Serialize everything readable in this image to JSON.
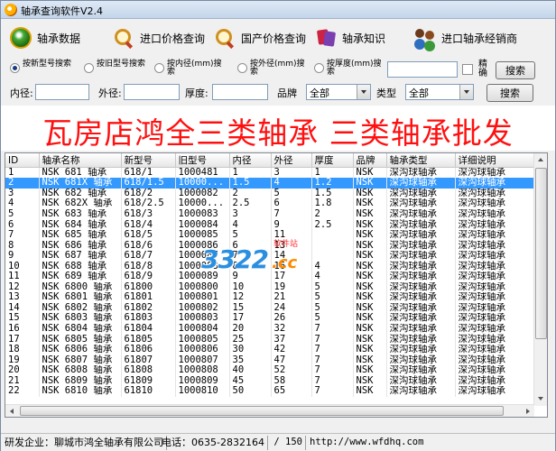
{
  "window": {
    "title": "轴承查询软件V2.4"
  },
  "toolbar": [
    {
      "label": "轴承数据",
      "icon": "bearing-data-icon"
    },
    {
      "label": "进口价格查询",
      "icon": "search-icon"
    },
    {
      "label": "国产价格查询",
      "icon": "search-icon"
    },
    {
      "label": "轴承知识",
      "icon": "books-icon"
    },
    {
      "label": "进口轴承经销商",
      "icon": "users-icon"
    }
  ],
  "search": {
    "radios": [
      {
        "label": "按新型号搜索",
        "checked": true
      },
      {
        "label": "按旧型号搜索",
        "checked": false
      },
      {
        "label": "按内径(mm)搜索",
        "checked": false
      },
      {
        "label": "按外径(mm)搜索",
        "checked": false
      },
      {
        "label": "按厚度(mm)搜索",
        "checked": false
      }
    ],
    "keyword_value": "",
    "exact_label": "精确",
    "exact_checked": false,
    "search_button": "搜索",
    "inner_label": "内径:",
    "outer_label": "外径:",
    "thickness_label": "厚度:",
    "brand_label": "品牌",
    "brand_value": "全部",
    "type_label": "类型",
    "type_value": "全部",
    "search_button2": "搜索"
  },
  "banner": {
    "text": "瓦房店鸿全三类轴承  三类轴承批发"
  },
  "table": {
    "columns": [
      "ID",
      "轴承名称",
      "新型号",
      "旧型号",
      "内径",
      "外径",
      "厚度",
      "品牌",
      "轴承类型",
      "详细说明"
    ],
    "selected_index": 1,
    "rows": [
      [
        "1",
        "NSK 681 轴承",
        "618/1",
        "1000481",
        "1",
        "3",
        "1",
        "NSK",
        "深沟球轴承",
        "深沟球轴承"
      ],
      [
        "2",
        "NSK 681X 轴承",
        "618/1.5",
        "10000...",
        "1.5",
        "4",
        "1.2",
        "NSK",
        "深沟球轴承",
        "深沟球轴承"
      ],
      [
        "3",
        "NSK 682 轴承",
        "618/2",
        "1000082",
        "2",
        "5",
        "1.5",
        "NSK",
        "深沟球轴承",
        "深沟球轴承"
      ],
      [
        "4",
        "NSK 682X 轴承",
        "618/2.5",
        "10000...",
        "2.5",
        "6",
        "1.8",
        "NSK",
        "深沟球轴承",
        "深沟球轴承"
      ],
      [
        "5",
        "NSK 683 轴承",
        "618/3",
        "1000083",
        "3",
        "7",
        "2",
        "NSK",
        "深沟球轴承",
        "深沟球轴承"
      ],
      [
        "6",
        "NSK 684 轴承",
        "618/4",
        "1000084",
        "4",
        "9",
        "2.5",
        "NSK",
        "深沟球轴承",
        "深沟球轴承"
      ],
      [
        "7",
        "NSK 685 轴承",
        "618/5",
        "1000085",
        "5",
        "11",
        "",
        "NSK",
        "深沟球轴承",
        "深沟球轴承"
      ],
      [
        "8",
        "NSK 686 轴承",
        "618/6",
        "1000086",
        "6",
        "13",
        "",
        "NSK",
        "深沟球轴承",
        "深沟球轴承"
      ],
      [
        "9",
        "NSK 687 轴承",
        "618/7",
        "1000087",
        "7",
        "14",
        "",
        "NSK",
        "深沟球轴承",
        "深沟球轴承"
      ],
      [
        "10",
        "NSK 688 轴承",
        "618/8",
        "1000088",
        "8",
        "16",
        "4",
        "NSK",
        "深沟球轴承",
        "深沟球轴承"
      ],
      [
        "11",
        "NSK 689 轴承",
        "618/9",
        "1000089",
        "9",
        "17",
        "4",
        "NSK",
        "深沟球轴承",
        "深沟球轴承"
      ],
      [
        "12",
        "NSK 6800 轴承",
        "61800",
        "1000800",
        "10",
        "19",
        "5",
        "NSK",
        "深沟球轴承",
        "深沟球轴承"
      ],
      [
        "13",
        "NSK 6801 轴承",
        "61801",
        "1000801",
        "12",
        "21",
        "5",
        "NSK",
        "深沟球轴承",
        "深沟球轴承"
      ],
      [
        "14",
        "NSK 6802 轴承",
        "61802",
        "1000802",
        "15",
        "24",
        "5",
        "NSK",
        "深沟球轴承",
        "深沟球轴承"
      ],
      [
        "15",
        "NSK 6803 轴承",
        "61803",
        "1000803",
        "17",
        "26",
        "5",
        "NSK",
        "深沟球轴承",
        "深沟球轴承"
      ],
      [
        "16",
        "NSK 6804 轴承",
        "61804",
        "1000804",
        "20",
        "32",
        "7",
        "NSK",
        "深沟球轴承",
        "深沟球轴承"
      ],
      [
        "17",
        "NSK 6805 轴承",
        "61805",
        "1000805",
        "25",
        "37",
        "7",
        "NSK",
        "深沟球轴承",
        "深沟球轴承"
      ],
      [
        "18",
        "NSK 6806 轴承",
        "61806",
        "1000806",
        "30",
        "42",
        "7",
        "NSK",
        "深沟球轴承",
        "深沟球轴承"
      ],
      [
        "19",
        "NSK 6807 轴承",
        "61807",
        "1000807",
        "35",
        "47",
        "7",
        "NSK",
        "深沟球轴承",
        "深沟球轴承"
      ],
      [
        "20",
        "NSK 6808 轴承",
        "61808",
        "1000808",
        "40",
        "52",
        "7",
        "NSK",
        "深沟球轴承",
        "深沟球轴承"
      ],
      [
        "21",
        "NSK 6809 轴承",
        "61809",
        "1000809",
        "45",
        "58",
        "7",
        "NSK",
        "深沟球轴承",
        "深沟球轴承"
      ],
      [
        "22",
        "NSK 6810 轴承",
        "61810",
        "1000810",
        "50",
        "65",
        "7",
        "NSK",
        "深沟球轴承",
        "深沟球轴承"
      ]
    ]
  },
  "watermark": {
    "number": "3322",
    "cc": ".cc",
    "site": "软件站"
  },
  "status": {
    "developer": "研发企业：聊城市鸿全轴承有限公司",
    "phone": "电话：0635-2832164",
    "pages": "/  150",
    "url": "http://www.wfdhq.com"
  }
}
